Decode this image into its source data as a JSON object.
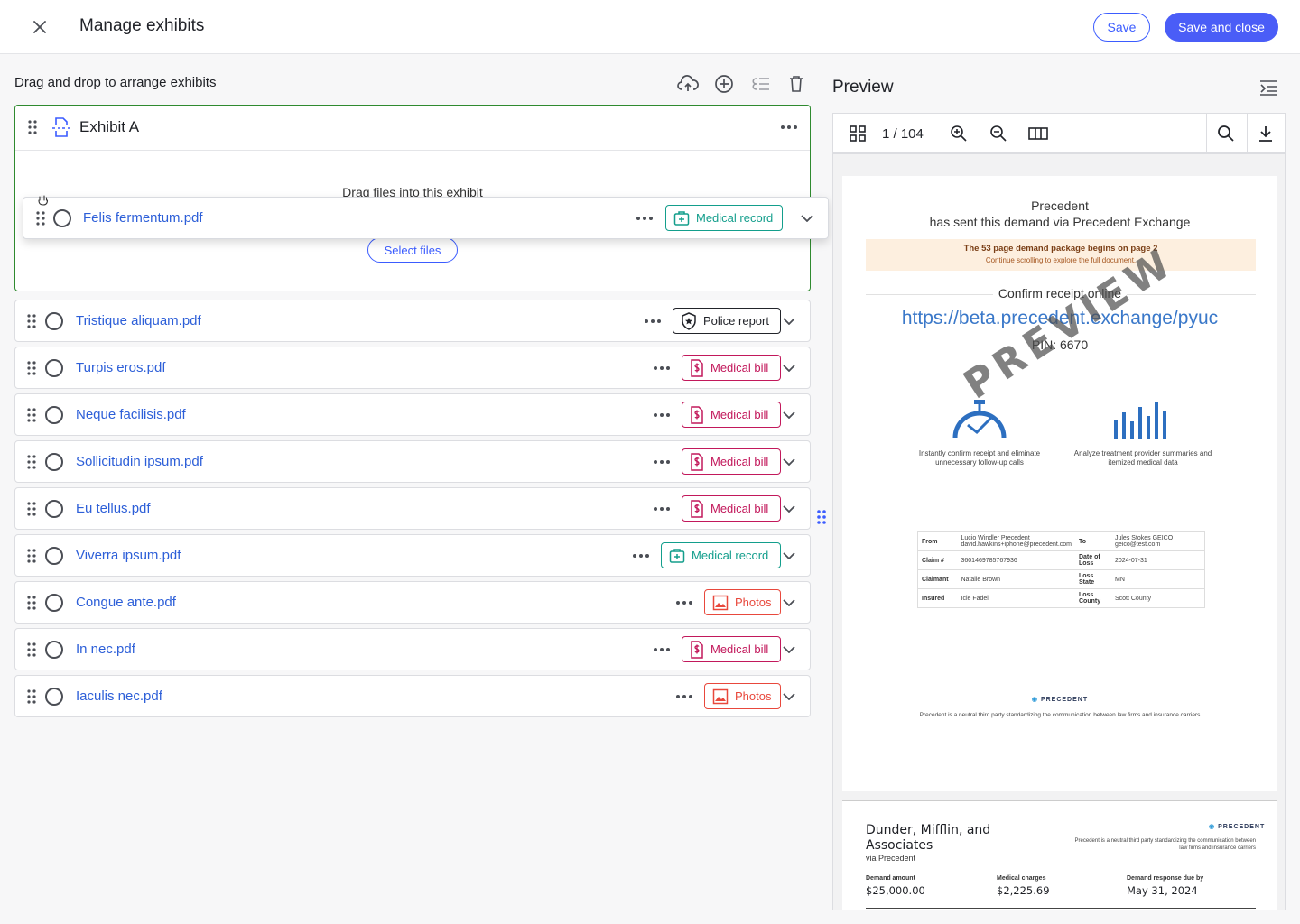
{
  "header": {
    "title": "Manage exhibits",
    "save_label": "Save",
    "save_close_label": "Save and close"
  },
  "left": {
    "title": "Drag and drop to arrange exhibits",
    "toolbar_icons": [
      "cloud-upload-icon",
      "add-circle-icon",
      "indent-icon",
      "trash-icon"
    ]
  },
  "exhibit": {
    "title": "Exhibit A",
    "drop_text": "Drag files into this exhibit",
    "select_files_label": "Select files"
  },
  "dragging": {
    "filename": "Felis fermentum.pdf",
    "tag": "Medical record"
  },
  "files": [
    {
      "name": "Tristique aliquam.pdf",
      "tag": "Police report"
    },
    {
      "name": "Turpis eros.pdf",
      "tag": "Medical bill"
    },
    {
      "name": "Neque facilisis.pdf",
      "tag": "Medical bill"
    },
    {
      "name": "Sollicitudin ipsum.pdf",
      "tag": "Medical bill"
    },
    {
      "name": "Eu tellus.pdf",
      "tag": "Medical bill"
    },
    {
      "name": "Viverra ipsum.pdf",
      "tag": "Medical record"
    },
    {
      "name": "Congue ante.pdf",
      "tag": "Photos"
    },
    {
      "name": "In nec.pdf",
      "tag": "Medical bill"
    },
    {
      "name": "Iaculis nec.pdf",
      "tag": "Photos"
    }
  ],
  "preview": {
    "title": "Preview",
    "page_indicator": "1 / 104",
    "page1": {
      "title_line1": "Precedent",
      "title_line2": "has sent this demand via Precedent Exchange",
      "banner_line1": "The 53 page demand package begins on page 2",
      "banner_line2": "Continue scrolling to explore the full document.",
      "confirm": "Confirm receipt online",
      "link": "https://beta.precedent.exchange/pyuc",
      "pin": "PIN: 6670",
      "watermark": "PREVIEW",
      "feature1": "Instantly confirm receipt and eliminate unnecessary follow-up calls",
      "feature2": "Analyze treatment provider summaries and itemized medical data",
      "table": {
        "from_label": "From",
        "from_value": "Lucio Windler Precedent david.hawkins+iphone@precedent.com",
        "to_label": "To",
        "to_value": "Jules Stokes GEICO geico@test.com",
        "claim_label": "Claim #",
        "claim_value": "3601469785767936",
        "dol_label": "Date of Loss",
        "dol_value": "2024-07-31",
        "claimant_label": "Claimant",
        "claimant_value": "Natalie Brown",
        "state_label": "Loss State",
        "state_value": "MN",
        "insured_label": "Insured",
        "insured_value": "Icie Fadel",
        "county_label": "Loss County",
        "county_value": "Scott County"
      },
      "logo": "PRECEDENT",
      "footer": "Precedent is a neutral third party standardizing the communication between law firms and insurance carriers"
    },
    "page2": {
      "firm": "Dunder, Mifflin, and Associates",
      "via": "via Precedent",
      "logo": "PRECEDENT",
      "tagline": "Precedent is a neutral third party standardizing the communication between law firms and insurance carriers",
      "demand_amount_label": "Demand amount",
      "demand_amount": "$25,000.00",
      "medical_charges_label": "Medical charges",
      "medical_charges": "$2,225.69",
      "response_due_label": "Demand response due by",
      "response_due": "May 31, 2024"
    }
  }
}
